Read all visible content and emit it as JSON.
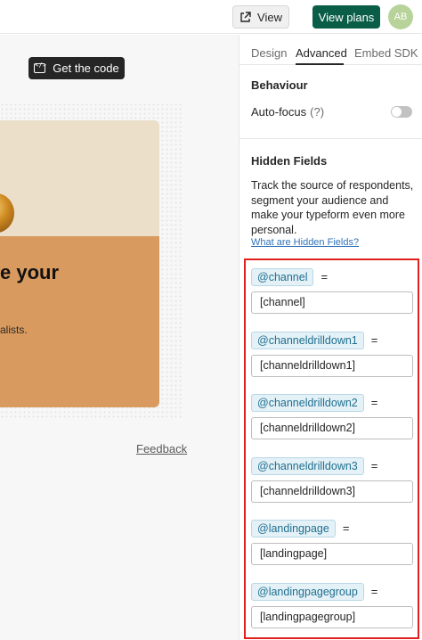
{
  "topbar": {
    "view_label": "View",
    "view_plans_label": "View plans",
    "avatar_initials": "AB"
  },
  "canvas": {
    "get_code_label": "Get the code",
    "card_heading": "e your",
    "card_text": "alists.",
    "feedback_label": "Feedback"
  },
  "panel": {
    "tabs": [
      {
        "label": "Design",
        "active": false
      },
      {
        "label": "Advanced",
        "active": true
      },
      {
        "label": "Embed SDK",
        "active": false
      }
    ],
    "behaviour": {
      "title": "Behaviour",
      "autofocus_label": "Auto-focus",
      "autofocus_help": "(?)",
      "autofocus_on": false
    },
    "hidden_fields": {
      "title": "Hidden Fields",
      "description": "Track the source of respondents, segment your audience and make your typeform even more personal.",
      "link_label": "What are Hidden Fields?",
      "fields": [
        {
          "chip": "@channel",
          "equals": "=",
          "value": "[channel]"
        },
        {
          "chip": "@channeldrilldown1",
          "equals": "=",
          "value": "[channeldrilldown1]"
        },
        {
          "chip": "@channeldrilldown2",
          "equals": "=",
          "value": "[channeldrilldown2]"
        },
        {
          "chip": "@channeldrilldown3",
          "equals": "=",
          "value": "[channeldrilldown3]"
        },
        {
          "chip": "@landingpage",
          "equals": "=",
          "value": "[landingpage]"
        },
        {
          "chip": "@landingpagegroup",
          "equals": "=",
          "value": "[landingpagegroup]"
        }
      ]
    }
  },
  "colors": {
    "primary": "#0a5e48",
    "highlight_border": "#e0211d",
    "chip_text": "#1f6f8f",
    "card_accent": "#d89a5e"
  }
}
